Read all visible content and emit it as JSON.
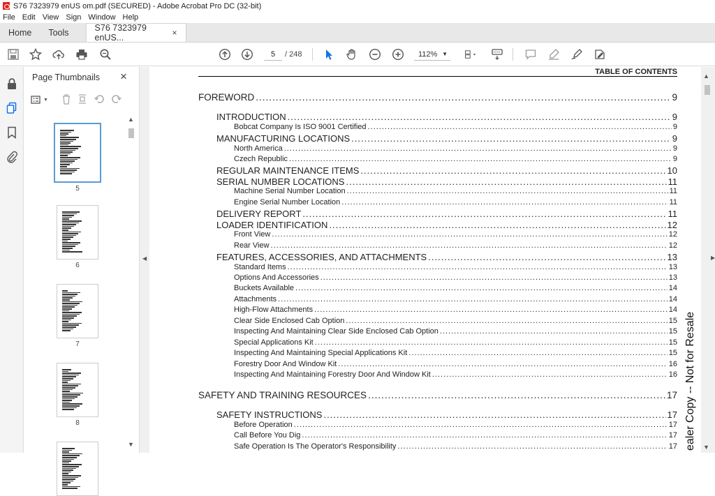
{
  "window": {
    "title": "S76 7323979 enUS om.pdf (SECURED) - Adobe Acrobat Pro DC (32-bit)"
  },
  "menu": [
    "File",
    "Edit",
    "View",
    "Sign",
    "Window",
    "Help"
  ],
  "tabs": {
    "home": "Home",
    "tools": "Tools",
    "document": "S76 7323979 enUS...",
    "close": "×"
  },
  "toolbar": {
    "page_current": "5",
    "page_total": "/ 248",
    "zoom": "112%"
  },
  "thumbnails": {
    "title": "Page Thumbnails",
    "close": "×",
    "pages": [
      "5",
      "6",
      "7",
      "8"
    ]
  },
  "toc": {
    "header": "TABLE OF CONTENTS",
    "entries": [
      {
        "level": 0,
        "title": "FOREWORD",
        "page": "9"
      },
      {
        "level": 1,
        "title": "INTRODUCTION",
        "page": "9"
      },
      {
        "level": 2,
        "title": "Bobcat Company Is ISO 9001 Certified",
        "page": "9"
      },
      {
        "level": 1,
        "title": "MANUFACTURING LOCATIONS",
        "page": "9"
      },
      {
        "level": 2,
        "title": "North America",
        "page": "9"
      },
      {
        "level": 2,
        "title": "Czech Republic",
        "page": "9"
      },
      {
        "level": 1,
        "title": "REGULAR MAINTENANCE ITEMS",
        "page": "10"
      },
      {
        "level": 1,
        "title": "SERIAL NUMBER LOCATIONS",
        "page": "11"
      },
      {
        "level": 2,
        "title": "Machine Serial Number Location",
        "page": "11"
      },
      {
        "level": 2,
        "title": "Engine Serial Number Location",
        "page": "11"
      },
      {
        "level": 1,
        "title": "DELIVERY REPORT",
        "page": "11"
      },
      {
        "level": 1,
        "title": "LOADER IDENTIFICATION",
        "page": "12"
      },
      {
        "level": 2,
        "title": "Front View",
        "page": "12"
      },
      {
        "level": 2,
        "title": "Rear View",
        "page": "12"
      },
      {
        "level": 1,
        "title": "FEATURES, ACCESSORIES, AND ATTACHMENTS",
        "page": "13"
      },
      {
        "level": 2,
        "title": "Standard Items",
        "page": "13"
      },
      {
        "level": 2,
        "title": "Options And Accessories",
        "page": "13"
      },
      {
        "level": 2,
        "title": "Buckets Available",
        "page": "14"
      },
      {
        "level": 2,
        "title": "Attachments",
        "page": "14"
      },
      {
        "level": 2,
        "title": "High-Flow Attachments",
        "page": "14"
      },
      {
        "level": 2,
        "title": "Clear Side Enclosed Cab Option",
        "page": "15"
      },
      {
        "level": 2,
        "title": "Inspecting And Maintaining Clear Side Enclosed Cab Option",
        "page": "15"
      },
      {
        "level": 2,
        "title": "Special Applications Kit",
        "page": "15"
      },
      {
        "level": 2,
        "title": "Inspecting And Maintaining Special Applications Kit",
        "page": "15"
      },
      {
        "level": 2,
        "title": "Forestry Door And Window Kit",
        "page": "16"
      },
      {
        "level": 2,
        "title": "Inspecting And Maintaining Forestry Door And Window Kit",
        "page": "16"
      },
      {
        "level": 0,
        "title": "SAFETY AND TRAINING RESOURCES",
        "page": "17"
      },
      {
        "level": 1,
        "title": "SAFETY INSTRUCTIONS",
        "page": "17"
      },
      {
        "level": 2,
        "title": "Before Operation",
        "page": "17"
      },
      {
        "level": 2,
        "title": "Call Before You Dig",
        "page": "17"
      },
      {
        "level": 2,
        "title": "Safe Operation Is The Operator's Responsibility",
        "page": "17"
      }
    ]
  },
  "watermark": "ealer Copy -- Not for Resale"
}
